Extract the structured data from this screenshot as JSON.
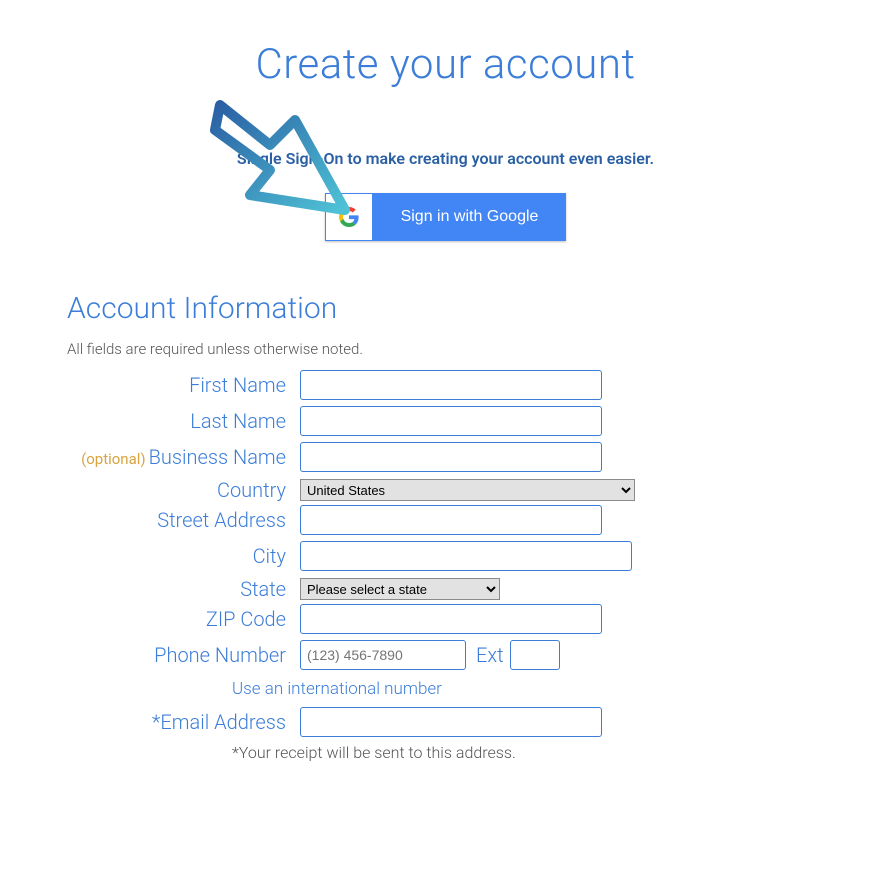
{
  "page": {
    "title": "Create your account",
    "sso_line": "Single Sign-On to make creating your account even easier.",
    "google_button": "Sign in with Google"
  },
  "section": {
    "title": "Account Information",
    "required_note": "All fields are required unless otherwise noted."
  },
  "form": {
    "first_name_label": "First Name",
    "last_name_label": "Last Name",
    "business_name_label": "Business Name",
    "optional_text": "(optional)",
    "country_label": "Country",
    "country_selected": "United States",
    "street_label": "Street Address",
    "city_label": "City",
    "state_label": "State",
    "state_selected": "Please select a state",
    "zip_label": "ZIP Code",
    "phone_label": "Phone Number",
    "phone_placeholder": "(123) 456-7890",
    "ext_label": "Ext",
    "intl_link": "Use an international number",
    "email_label": "*Email Address",
    "receipt_note": "*Your receipt will be sent to this address."
  }
}
